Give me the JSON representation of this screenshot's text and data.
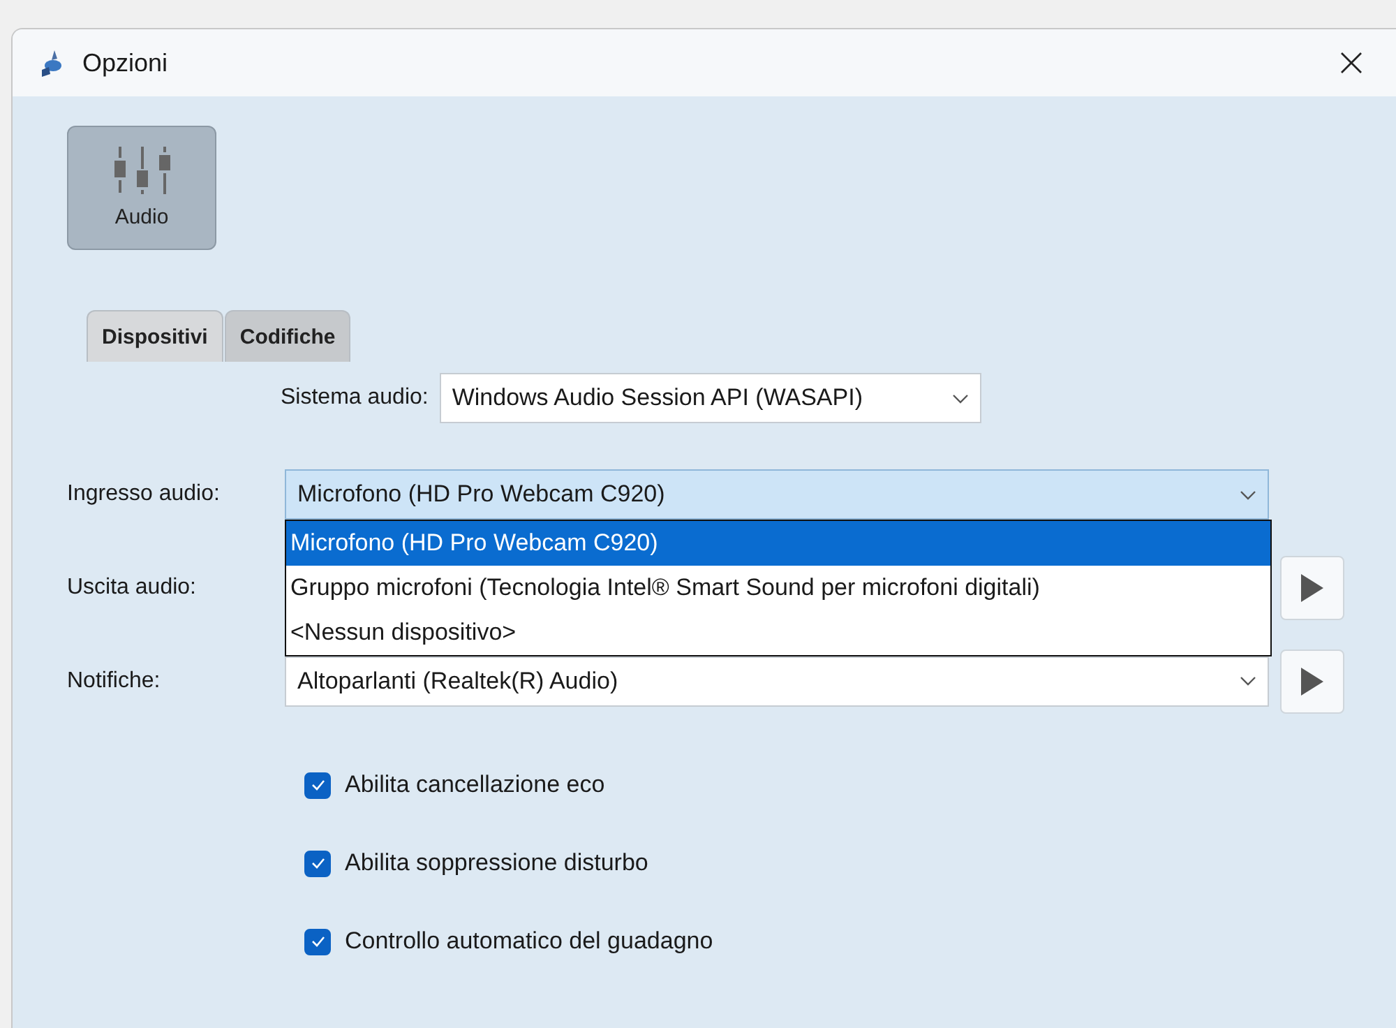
{
  "window": {
    "title": "Opzioni"
  },
  "categories": [
    {
      "label": "Audio",
      "selected": true
    }
  ],
  "tabs": [
    {
      "label": "Dispositivi",
      "selected": true
    },
    {
      "label": "Codifiche",
      "selected": false
    }
  ],
  "audio_system": {
    "label": "Sistema audio:",
    "value": "Windows Audio Session API (WASAPI)"
  },
  "devices": [
    {
      "label": "Ingresso audio:",
      "value": "Microfono (HD Pro Webcam C920)",
      "expanded": true,
      "options": [
        {
          "label": "Microfono (HD Pro Webcam C920)",
          "selected": true
        },
        {
          "label": "Gruppo microfoni (Tecnologia Intel® Smart Sound per microfoni digitali)",
          "selected": false
        },
        {
          "label": "<Nessun dispositivo>",
          "selected": false
        }
      ]
    },
    {
      "label": "Uscita audio:",
      "play_button": true
    },
    {
      "label": "Notifiche:",
      "value": "Altoparlanti (Realtek(R) Audio)",
      "play_button": true
    }
  ],
  "checkboxes": [
    {
      "label": "Abilita cancellazione eco",
      "checked": true
    },
    {
      "label": "Abilita soppressione disturbo",
      "checked": true
    },
    {
      "label": "Controllo automatico del guadagno",
      "checked": true
    }
  ]
}
